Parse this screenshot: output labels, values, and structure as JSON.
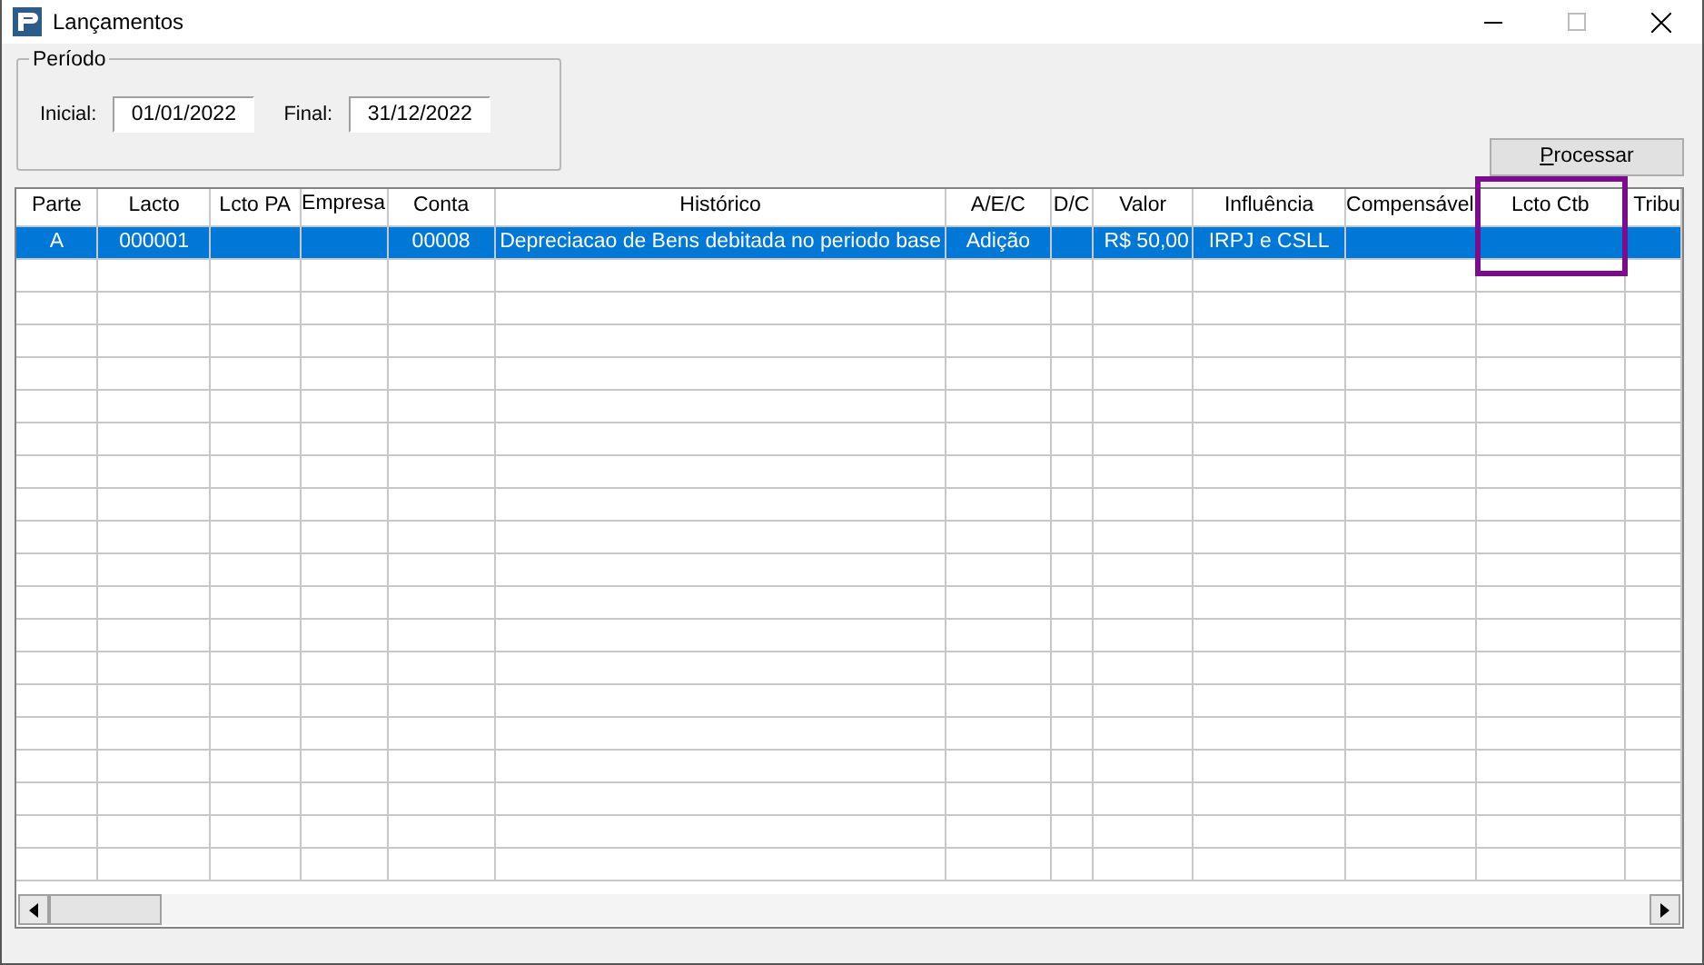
{
  "window": {
    "title": "Lançamentos"
  },
  "period": {
    "legend": "Período",
    "fields": [
      {
        "label": "Inicial:",
        "value": "01/01/2022"
      },
      {
        "label": "Final:",
        "value": "31/12/2022"
      }
    ]
  },
  "buttons": [
    {
      "label": "Processar"
    }
  ],
  "table": {
    "columns": [
      {
        "label": "Parte",
        "highlighted": false
      },
      {
        "label": "Lacto",
        "highlighted": false
      },
      {
        "label": "Lcto PA",
        "highlighted": false
      },
      {
        "label": "Empresa",
        "highlighted": false
      },
      {
        "label": "Conta",
        "highlighted": false
      },
      {
        "label": "Histórico",
        "highlighted": false
      },
      {
        "label": "A/E/C",
        "highlighted": false
      },
      {
        "label": "D/C",
        "highlighted": false
      },
      {
        "label": "Valor",
        "highlighted": false
      },
      {
        "label": "Influência",
        "highlighted": false
      },
      {
        "label": "Compensável",
        "highlighted": false
      },
      {
        "label": "Lcto Ctb",
        "highlighted": true
      },
      {
        "label": "Tribu",
        "highlighted": false
      }
    ],
    "rows": [
      {
        "selected": true,
        "cells": [
          "A",
          "000001",
          "",
          "",
          "00008",
          "Depreciacao de Bens debitada no periodo base",
          "Adição",
          "",
          "R$ 50,00",
          "IRPJ e CSLL",
          "",
          "",
          ""
        ]
      }
    ]
  }
}
